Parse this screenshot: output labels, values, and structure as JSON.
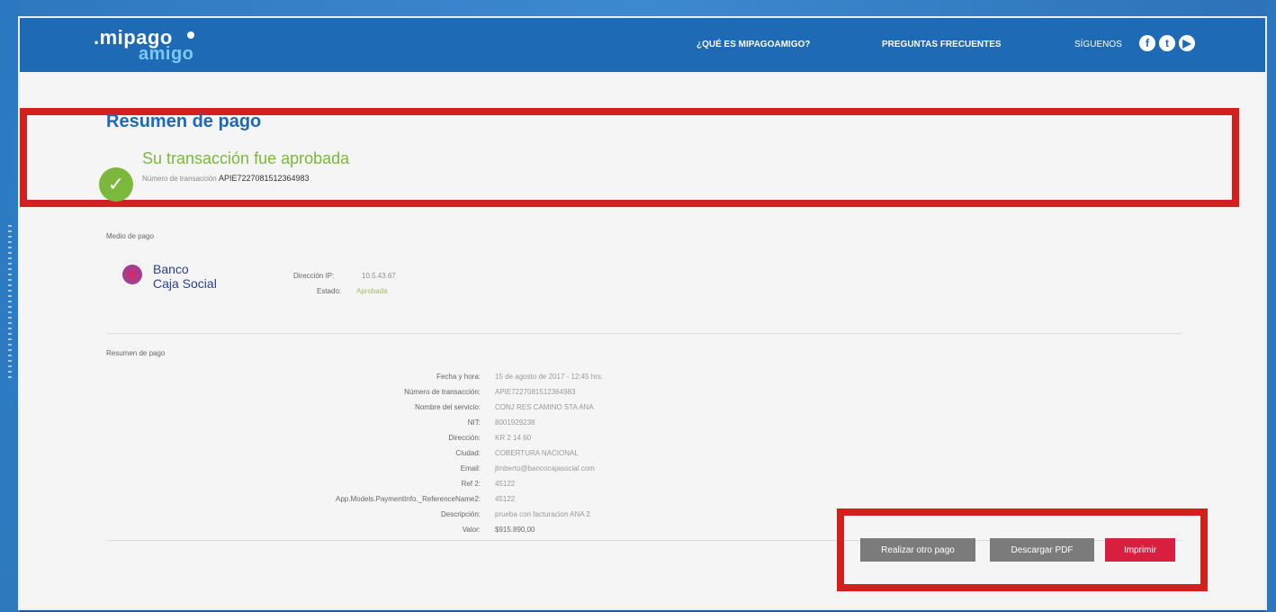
{
  "header": {
    "logo_line1": ".mipago",
    "logo_line2": "amigo",
    "nav_1": "¿QUÉ ES MIPAGOAMIGO?",
    "nav_2": "PREGUNTAS FRECUENTES",
    "nav_3": "SÍGUENOS"
  },
  "summary": {
    "title": "Resumen de pago",
    "approved": "Su transacción fue aprobada",
    "transaction_label": "Número de transacción",
    "transaction_value": "APIE7227081512364983"
  },
  "payment_method": {
    "section_title": "Medio de pago",
    "bank_line1": "Banco",
    "bank_line2": "Caja Social",
    "ip_label": "Dirección IP:",
    "ip_value": "10.5.43.67",
    "status_label": "Estado:",
    "status_value": "Aprobada"
  },
  "details": {
    "section_title": "Resumen de pago",
    "rows": [
      {
        "label": "Fecha y hora:",
        "value": "15 de agosto de 2017 - 12:45 hrs."
      },
      {
        "label": "Número de transacción:",
        "value": "APIE7227081512364983"
      },
      {
        "label": "Nombre del servicio:",
        "value": "CONJ RES CAMINO STA ANA"
      },
      {
        "label": "NIT:",
        "value": "8001929238"
      },
      {
        "label": "Dirección:",
        "value": "KR 2 14 60"
      },
      {
        "label": "Ciudad:",
        "value": "COBERTURA NACIONAL"
      },
      {
        "label": "Email:",
        "value": "jlmberto@bancocajasocial.com"
      },
      {
        "label": "Ref 2:",
        "value": "45122"
      },
      {
        "label": "App.Models.PaymentInfo._ReferenceName2:",
        "value": "45122"
      },
      {
        "label": "Descripción:",
        "value": "prueba con facturacion ANA 2"
      },
      {
        "label": "Valor:",
        "value": "$915.890,00"
      }
    ]
  },
  "actions": {
    "button_1": "Realizar otro pago",
    "button_2": "Descargar PDF",
    "button_3": "Imprimir"
  }
}
